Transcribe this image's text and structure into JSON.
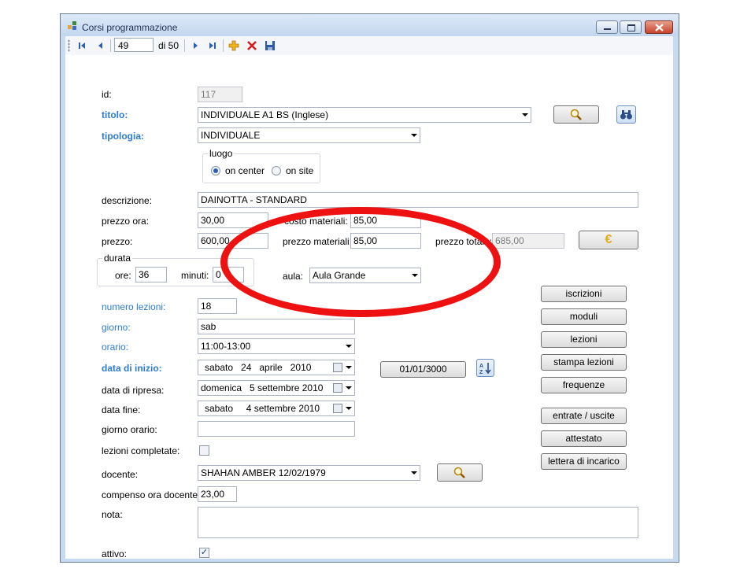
{
  "window": {
    "title": "Corsi programmazione"
  },
  "navigator": {
    "position": "49",
    "count_label": "di 50"
  },
  "icons": {
    "move_first": "move-first-icon",
    "move_previous": "move-previous-icon",
    "move_next": "move-next-icon",
    "move_last": "move-last-icon",
    "add_new": "add-icon",
    "delete": "delete-icon",
    "save": "save-icon",
    "search": "search-icon",
    "binoculars": "binoculars-icon",
    "euro": "euro-icon",
    "sort": "sort-az-icon"
  },
  "colors": {
    "accent_label": "#2c7bd3",
    "annotation": "#ee1111"
  },
  "form": {
    "id": {
      "label": "id:",
      "value": "117"
    },
    "titolo": {
      "label": "titolo:",
      "value": "INDIVIDUALE A1 BS (Inglese)"
    },
    "tipologia": {
      "label": "tipologia:",
      "value": "INDIVIDUALE"
    },
    "luogo": {
      "label": "luogo",
      "option_center": "on center",
      "option_site": "on site",
      "selected": "on center"
    },
    "descrizione": {
      "label": "descrizione:",
      "value": "DAINOTTA - STANDARD"
    },
    "prezzo_ora": {
      "label": "prezzo ora:",
      "value": "30,00"
    },
    "costo_materiali": {
      "label": "costo materiali:",
      "value": "85,00"
    },
    "prezzo": {
      "label": "prezzo:",
      "value": "600,00"
    },
    "prezzo_materiali": {
      "label": "prezzo materiali:",
      "value": "85,00"
    },
    "prezzo_totale": {
      "label": "prezzo totale:",
      "value": "685,00"
    },
    "durata": {
      "label": "durata",
      "ore_label": "ore:",
      "ore_value": "36",
      "minuti_label": "minuti:",
      "minuti_value": "0"
    },
    "aula": {
      "label": "aula:",
      "value": "Aula Grande"
    },
    "numero_lezioni": {
      "label": "numero lezioni:",
      "value": "18"
    },
    "giorno": {
      "label": "giorno:",
      "value": "sab"
    },
    "orario": {
      "label": "orario:",
      "value": "11:00-13:00"
    },
    "data_inizio": {
      "label": "data di inizio:",
      "value": "sabato   24   aprile   2010"
    },
    "data_ripresa": {
      "label": "data di ripresa:",
      "value": "domenica   5 settembre 2010"
    },
    "data_fine": {
      "label": "data fine:",
      "value": "sabato     4 settembre 2010"
    },
    "giorno_orario": {
      "label": "giorno orario:",
      "value": ""
    },
    "lezioni_completate": {
      "label": "lezioni completate:",
      "checked": false
    },
    "docente": {
      "label": "docente:",
      "value": "SHAHAN AMBER 12/02/1979"
    },
    "compenso": {
      "label": "compenso ora docente:",
      "value": "23,00"
    },
    "nota": {
      "label": "nota:",
      "value": ""
    },
    "attivo": {
      "label": "attivo:",
      "checked": true,
      "check_mark": "✓"
    }
  },
  "buttons": {
    "date_button": "01/01/3000",
    "iscrizioni": "iscrizioni",
    "moduli": "moduli",
    "lezioni": "lezioni",
    "stampa_lezioni": "stampa lezioni",
    "frequenze": "frequenze",
    "entrate_uscite": "entrate / uscite",
    "attestato": "attestato",
    "lettera_incarico": "lettera di incarico"
  }
}
